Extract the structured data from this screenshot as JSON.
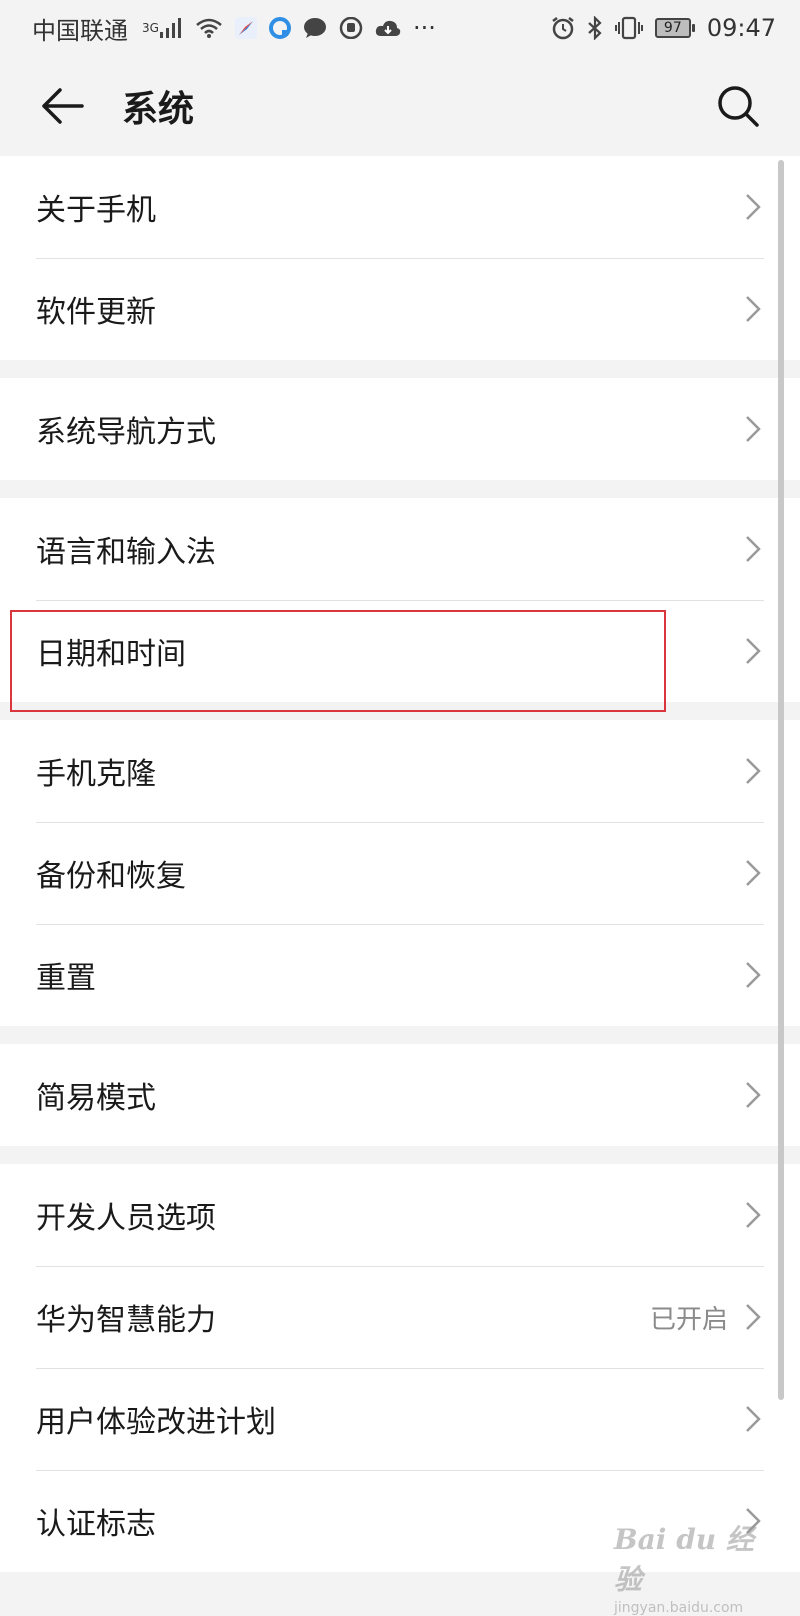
{
  "status_bar": {
    "carrier": "中国联通",
    "network_badge": "3G",
    "battery": "97",
    "time": "09:47",
    "icons_left": [
      "signal-icon",
      "wifi-icon",
      "compass-app-icon",
      "browser-app-icon",
      "message-icon",
      "hand-icon",
      "cloud-icon",
      "more-notifications-icon"
    ],
    "icons_right": [
      "alarm-icon",
      "bluetooth-icon",
      "vibrate-icon"
    ],
    "overflow": "···"
  },
  "app_bar": {
    "title": "系统",
    "back_icon": "back-arrow-icon",
    "search_icon": "search-icon"
  },
  "groups": [
    {
      "items": [
        {
          "label": "关于手机"
        },
        {
          "label": "软件更新"
        }
      ]
    },
    {
      "items": [
        {
          "label": "系统导航方式"
        }
      ]
    },
    {
      "items": [
        {
          "label": "语言和输入法"
        },
        {
          "label": "日期和时间"
        }
      ]
    },
    {
      "items": [
        {
          "label": "手机克隆"
        },
        {
          "label": "备份和恢复"
        },
        {
          "label": "重置"
        }
      ]
    },
    {
      "items": [
        {
          "label": "简易模式"
        }
      ]
    },
    {
      "items": [
        {
          "label": "开发人员选项"
        },
        {
          "label": "华为智慧能力",
          "value": "已开启"
        },
        {
          "label": "用户体验改进计划"
        },
        {
          "label": "认证标志"
        }
      ]
    }
  ],
  "highlight": {
    "target": "日期和时间",
    "color": "#d9363e"
  },
  "watermark": {
    "main": "Bai du 经验",
    "sub": "jingyan.baidu.com"
  },
  "colors": {
    "background": "#f3f3f3",
    "card": "#ffffff",
    "divider": "#e2e2e2",
    "secondary_text": "#8a8a8a"
  }
}
